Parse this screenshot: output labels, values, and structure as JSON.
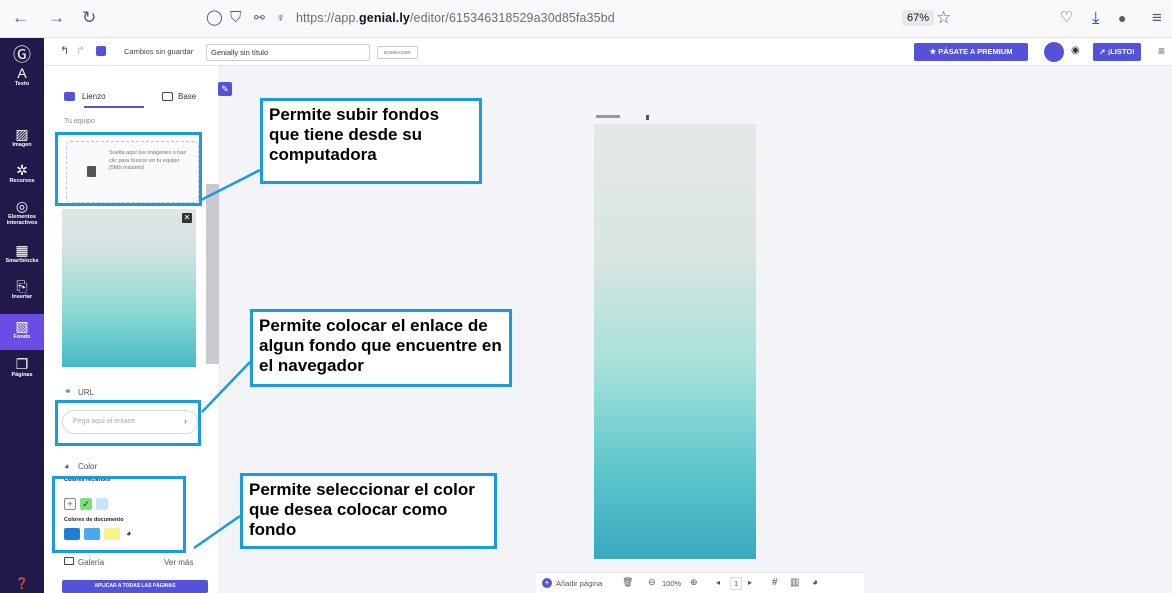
{
  "browser": {
    "url_prefix": "https://app.",
    "url_domain": "genial.ly",
    "url_path": "/editor/615346318529a30d85fa35bd",
    "zoom": "67%"
  },
  "left_nav": [
    {
      "label": "Texto",
      "icon": "text-icon",
      "glyph": "A"
    },
    {
      "label": "Imagen",
      "icon": "image-icon",
      "glyph": "▨"
    },
    {
      "label": "Recursos",
      "icon": "resources-icon",
      "glyph": "✲"
    },
    {
      "label": "Elementos interactivos",
      "icon": "interactive-icon",
      "glyph": "◎"
    },
    {
      "label": "Smartblocks",
      "icon": "smartblocks-icon",
      "glyph": "▦"
    },
    {
      "label": "Insertar",
      "icon": "insert-icon",
      "glyph": "⎘"
    },
    {
      "label": "Fondo",
      "icon": "background-icon",
      "glyph": "▧"
    },
    {
      "label": "Páginas",
      "icon": "pages-icon",
      "glyph": "❐"
    }
  ],
  "toolbar": {
    "save_status": "Cambios sin guardar",
    "title": "Genially sin título",
    "draft": "BORRADOR",
    "premium": "PÁSATE A PREMIUM",
    "ready": "¡LISTO!"
  },
  "panel": {
    "tab_canvas": "Lienzo",
    "tab_base": "Base",
    "team_label": "Tu equipo",
    "upload_text": "Suelta aquí tus imágenes o haz clic para buscar en tu equipo (5Mb máximo)",
    "url_heading": "URL",
    "url_placeholder": "Pega aquí el enlace",
    "color_heading": "Color",
    "recent_colors": "Colores recientes",
    "doc_colors": "Colores de documento",
    "gallery": "Galería",
    "see_more": "Ver más",
    "apply_all": "APLICAR A TODAS LAS PÁGINAS"
  },
  "colors": {
    "recent": [
      "#7ee07a",
      "#c9e4f7"
    ],
    "document": [
      "#1e7fd6",
      "#4aa8ec",
      "#f4f48a"
    ],
    "accent": "#5452d9",
    "callout_border": "#1a9be0"
  },
  "bottom_bar": {
    "add_page": "Añadir página",
    "zoom": "100%",
    "page": "1"
  },
  "callouts": {
    "upload": "Permite subir fondos que tiene desde su computadora",
    "url": "Permite colocar el enlace de algun fondo que encuentre en el navegador",
    "color": "Permite seleccionar el color que desea colocar como fondo"
  }
}
